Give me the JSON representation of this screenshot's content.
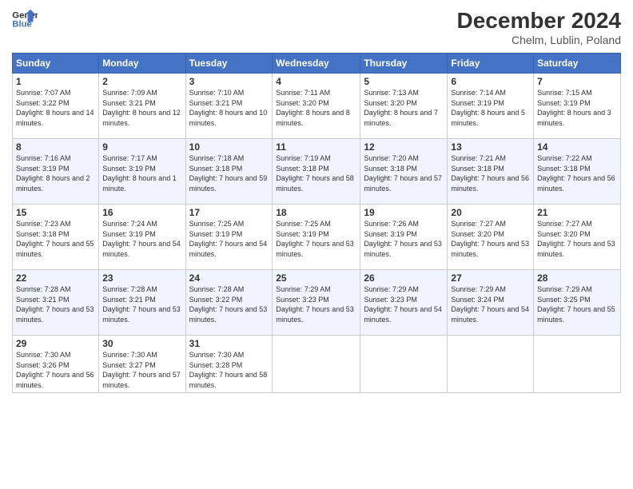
{
  "logo": {
    "line1": "General",
    "line2": "Blue"
  },
  "title": "December 2024",
  "subtitle": "Chelm, Lublin, Poland",
  "headers": [
    "Sunday",
    "Monday",
    "Tuesday",
    "Wednesday",
    "Thursday",
    "Friday",
    "Saturday"
  ],
  "weeks": [
    [
      {
        "day": "1",
        "sunrise": "7:07 AM",
        "sunset": "3:22 PM",
        "daylight": "8 hours and 14 minutes."
      },
      {
        "day": "2",
        "sunrise": "7:09 AM",
        "sunset": "3:21 PM",
        "daylight": "8 hours and 12 minutes."
      },
      {
        "day": "3",
        "sunrise": "7:10 AM",
        "sunset": "3:21 PM",
        "daylight": "8 hours and 10 minutes."
      },
      {
        "day": "4",
        "sunrise": "7:11 AM",
        "sunset": "3:20 PM",
        "daylight": "8 hours and 8 minutes."
      },
      {
        "day": "5",
        "sunrise": "7:13 AM",
        "sunset": "3:20 PM",
        "daylight": "8 hours and 7 minutes."
      },
      {
        "day": "6",
        "sunrise": "7:14 AM",
        "sunset": "3:19 PM",
        "daylight": "8 hours and 5 minutes."
      },
      {
        "day": "7",
        "sunrise": "7:15 AM",
        "sunset": "3:19 PM",
        "daylight": "8 hours and 3 minutes."
      }
    ],
    [
      {
        "day": "8",
        "sunrise": "7:16 AM",
        "sunset": "3:19 PM",
        "daylight": "8 hours and 2 minutes."
      },
      {
        "day": "9",
        "sunrise": "7:17 AM",
        "sunset": "3:19 PM",
        "daylight": "8 hours and 1 minute."
      },
      {
        "day": "10",
        "sunrise": "7:18 AM",
        "sunset": "3:18 PM",
        "daylight": "7 hours and 59 minutes."
      },
      {
        "day": "11",
        "sunrise": "7:19 AM",
        "sunset": "3:18 PM",
        "daylight": "7 hours and 58 minutes."
      },
      {
        "day": "12",
        "sunrise": "7:20 AM",
        "sunset": "3:18 PM",
        "daylight": "7 hours and 57 minutes."
      },
      {
        "day": "13",
        "sunrise": "7:21 AM",
        "sunset": "3:18 PM",
        "daylight": "7 hours and 56 minutes."
      },
      {
        "day": "14",
        "sunrise": "7:22 AM",
        "sunset": "3:18 PM",
        "daylight": "7 hours and 56 minutes."
      }
    ],
    [
      {
        "day": "15",
        "sunrise": "7:23 AM",
        "sunset": "3:18 PM",
        "daylight": "7 hours and 55 minutes."
      },
      {
        "day": "16",
        "sunrise": "7:24 AM",
        "sunset": "3:19 PM",
        "daylight": "7 hours and 54 minutes."
      },
      {
        "day": "17",
        "sunrise": "7:25 AM",
        "sunset": "3:19 PM",
        "daylight": "7 hours and 54 minutes."
      },
      {
        "day": "18",
        "sunrise": "7:25 AM",
        "sunset": "3:19 PM",
        "daylight": "7 hours and 53 minutes."
      },
      {
        "day": "19",
        "sunrise": "7:26 AM",
        "sunset": "3:19 PM",
        "daylight": "7 hours and 53 minutes."
      },
      {
        "day": "20",
        "sunrise": "7:27 AM",
        "sunset": "3:20 PM",
        "daylight": "7 hours and 53 minutes."
      },
      {
        "day": "21",
        "sunrise": "7:27 AM",
        "sunset": "3:20 PM",
        "daylight": "7 hours and 53 minutes."
      }
    ],
    [
      {
        "day": "22",
        "sunrise": "7:28 AM",
        "sunset": "3:21 PM",
        "daylight": "7 hours and 53 minutes."
      },
      {
        "day": "23",
        "sunrise": "7:28 AM",
        "sunset": "3:21 PM",
        "daylight": "7 hours and 53 minutes."
      },
      {
        "day": "24",
        "sunrise": "7:28 AM",
        "sunset": "3:22 PM",
        "daylight": "7 hours and 53 minutes."
      },
      {
        "day": "25",
        "sunrise": "7:29 AM",
        "sunset": "3:23 PM",
        "daylight": "7 hours and 53 minutes."
      },
      {
        "day": "26",
        "sunrise": "7:29 AM",
        "sunset": "3:23 PM",
        "daylight": "7 hours and 54 minutes."
      },
      {
        "day": "27",
        "sunrise": "7:29 AM",
        "sunset": "3:24 PM",
        "daylight": "7 hours and 54 minutes."
      },
      {
        "day": "28",
        "sunrise": "7:29 AM",
        "sunset": "3:25 PM",
        "daylight": "7 hours and 55 minutes."
      }
    ],
    [
      {
        "day": "29",
        "sunrise": "7:30 AM",
        "sunset": "3:26 PM",
        "daylight": "7 hours and 56 minutes."
      },
      {
        "day": "30",
        "sunrise": "7:30 AM",
        "sunset": "3:27 PM",
        "daylight": "7 hours and 57 minutes."
      },
      {
        "day": "31",
        "sunrise": "7:30 AM",
        "sunset": "3:28 PM",
        "daylight": "7 hours and 58 minutes."
      },
      null,
      null,
      null,
      null
    ]
  ]
}
